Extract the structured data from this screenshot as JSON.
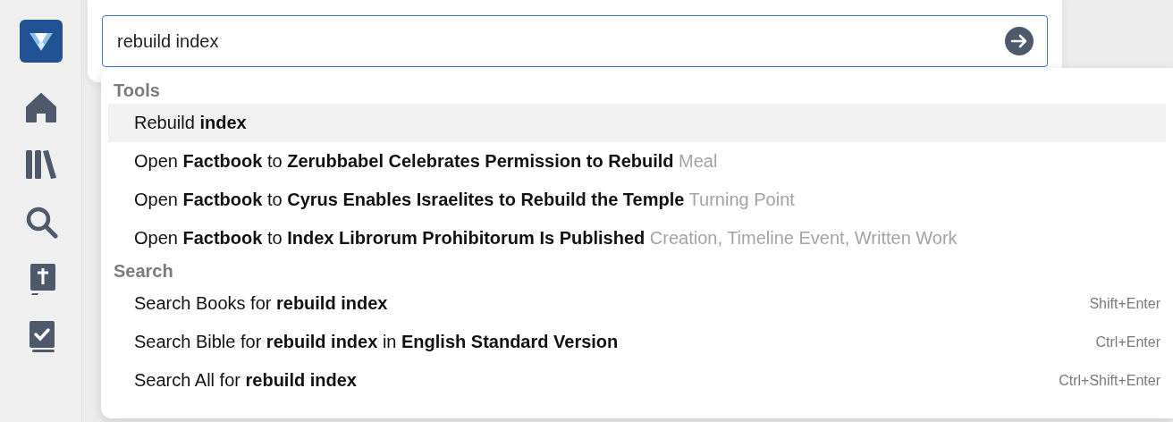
{
  "search": {
    "value": "rebuild index"
  },
  "groups": [
    {
      "title": "Tools",
      "items": [
        {
          "text": "Rebuild **index**",
          "selected": true
        },
        {
          "text": "Open **Factbook** to **Zerubbabel Celebrates Permission to Rebuild**",
          "detail": "Meal",
          "selected": false
        },
        {
          "text": "Open **Factbook** to **Cyrus Enables Israelites to Rebuild the Temple**",
          "detail": "Turning Point",
          "selected": false
        },
        {
          "text": "Open **Factbook** to **Index Librorum Prohibitorum Is Published**",
          "detail": "Creation, Timeline Event, Written Work",
          "selected": false
        }
      ]
    },
    {
      "title": "Search",
      "items": [
        {
          "text": "Search Books for **rebuild index**",
          "shortcut": "Shift+Enter",
          "selected": false
        },
        {
          "text": "Search Bible for **rebuild index** in **English Standard Version**",
          "shortcut": "Ctrl+Enter",
          "selected": false
        },
        {
          "text": "Search All for **rebuild index**",
          "shortcut": "Ctrl+Shift+Enter",
          "selected": false
        }
      ]
    }
  ]
}
